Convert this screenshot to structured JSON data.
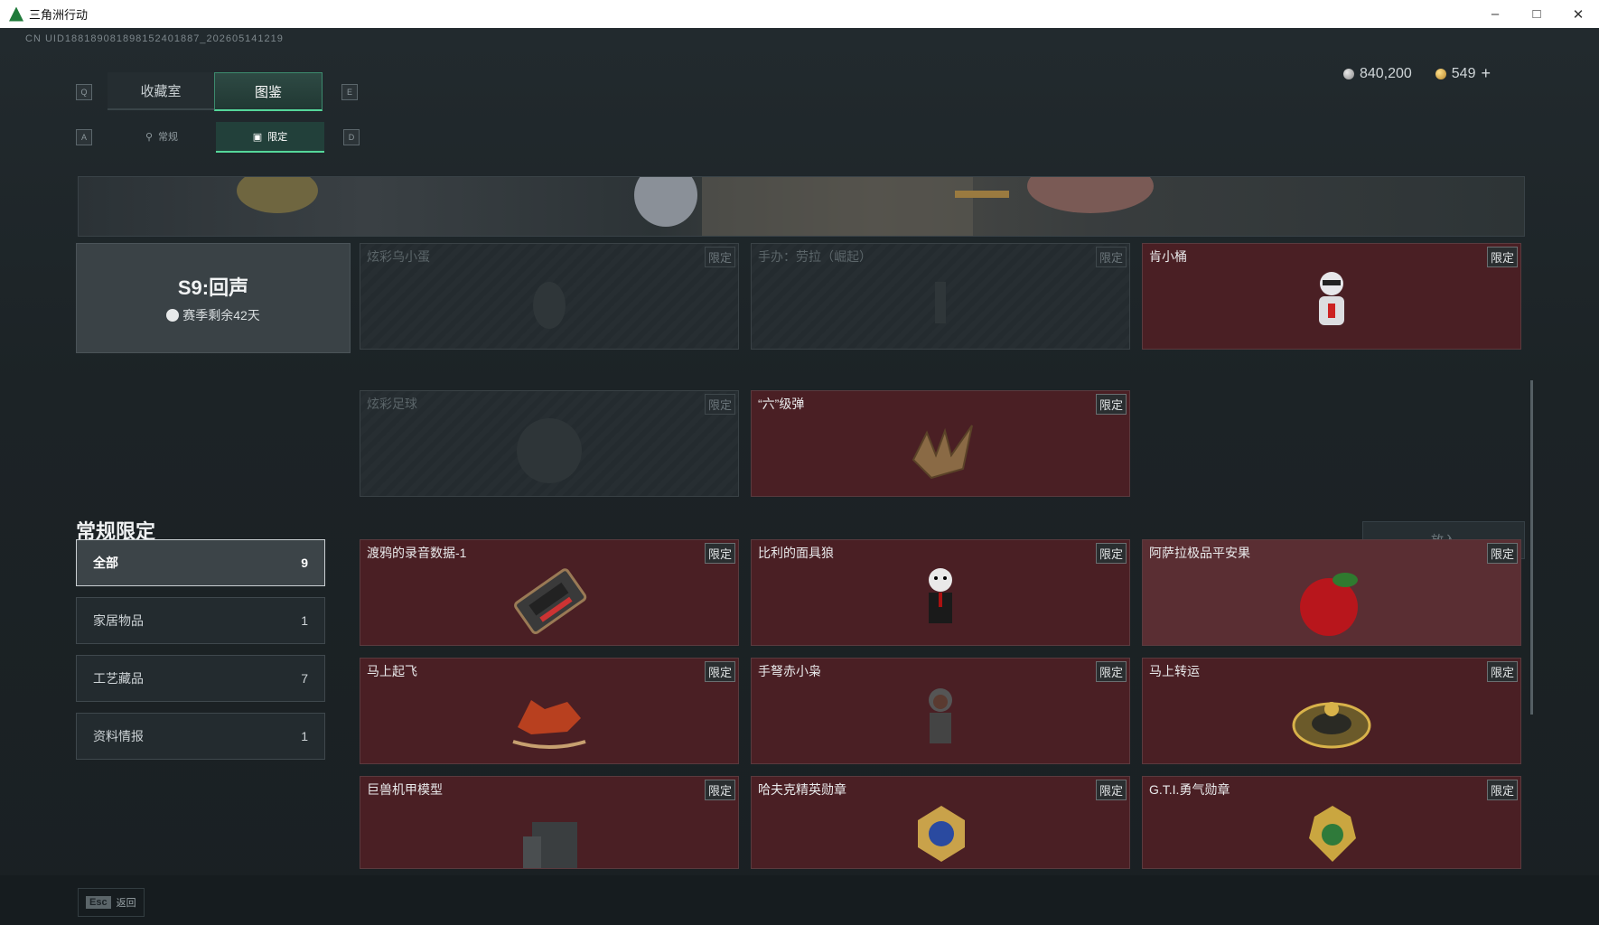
{
  "window": {
    "title": "三角洲行动",
    "minimize": "–",
    "maximize": "□",
    "close": "✕"
  },
  "uid": "CN UID1881890818981524018​87_202605141219",
  "currency": {
    "silver": "840,200",
    "gold": "549",
    "add": "+"
  },
  "keys": {
    "q": "Q",
    "e": "E",
    "a": "A",
    "d": "D"
  },
  "tabs": [
    {
      "label": "收藏室"
    },
    {
      "label": "图鉴"
    }
  ],
  "subtabs": [
    {
      "label": "常规"
    },
    {
      "label": "限定"
    }
  ],
  "season": {
    "name": "S9:回声",
    "remaining": "赛季剩余42天"
  },
  "season_items": [
    {
      "name": "炫彩乌小蛋",
      "tag": "限定"
    },
    {
      "name": "手办：劳拉（崛起）",
      "tag": "限定"
    },
    {
      "name": "肯小桶",
      "tag": "限定"
    },
    {
      "name": "炫彩足球",
      "tag": "限定"
    },
    {
      "name": "“六”级弹",
      "tag": "限定"
    }
  ],
  "section": {
    "title": "常规限定",
    "put_in": "放入"
  },
  "categories": [
    {
      "label": "全部",
      "count": "9"
    },
    {
      "label": "家居物品",
      "count": "1"
    },
    {
      "label": "工艺藏品",
      "count": "7"
    },
    {
      "label": "资料情报",
      "count": "1"
    }
  ],
  "items": [
    {
      "name": "渡鸦的录音数据-1",
      "tag": "限定"
    },
    {
      "name": "比利的面具狼",
      "tag": "限定"
    },
    {
      "name": "阿萨拉极品平安果",
      "tag": "限定"
    },
    {
      "name": "马上起飞",
      "tag": "限定"
    },
    {
      "name": "手弩赤小枭",
      "tag": "限定"
    },
    {
      "name": "马上转运",
      "tag": "限定"
    },
    {
      "name": "巨兽机甲模型",
      "tag": "限定"
    },
    {
      "name": "哈夫克精英勋章",
      "tag": "限定"
    },
    {
      "name": "G.T.I.勇气勋章",
      "tag": "限定"
    }
  ],
  "footer": {
    "key": "Esc",
    "label": "返回"
  }
}
